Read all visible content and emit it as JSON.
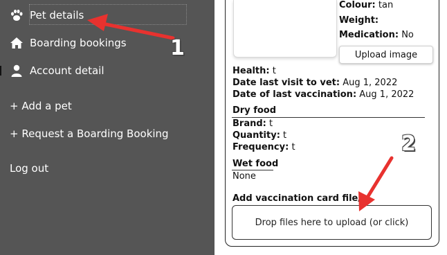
{
  "sidebar": {
    "items": [
      {
        "label": "Pet details",
        "icon": "paw-icon"
      },
      {
        "label": "Boarding bookings",
        "icon": "home-icon"
      },
      {
        "label": "Account detail",
        "icon": "user-icon"
      }
    ],
    "links": [
      {
        "label": "+ Add a pet"
      },
      {
        "label": "+ Request a Boarding Booking"
      },
      {
        "label": "Log out"
      }
    ]
  },
  "pet": {
    "colour_label": "Colour:",
    "colour_value": "tan",
    "weight_label": "Weight:",
    "weight_value": "",
    "medication_label": "Medication:",
    "medication_value": "No",
    "upload_image_label": "Upload image",
    "health_label": "Health:",
    "health_value": "t",
    "vet_visit_label": "Date last visit to vet:",
    "vet_visit_value": "Aug 1, 2022",
    "vaccination_label": "Date of last vaccination:",
    "vaccination_value": "Aug 1, 2022"
  },
  "dry_food": {
    "heading": "Dry food",
    "brand_label": "Brand:",
    "brand_value": "t",
    "quantity_label": "Quantity:",
    "quantity_value": "t",
    "frequency_label": "Frequency:",
    "frequency_value": "t"
  },
  "wet_food": {
    "heading": "Wet food",
    "value": "None"
  },
  "vaccination_upload": {
    "heading": "Add vaccination card file/s",
    "dropzone_label": "Drop files here to upload (or click)"
  },
  "annotations": {
    "callout_1": "1",
    "callout_2": "2",
    "arrow_color": "#e8322f"
  },
  "colors": {
    "sidebar_bg": "#555555",
    "sidebar_text": "#ffffff"
  }
}
